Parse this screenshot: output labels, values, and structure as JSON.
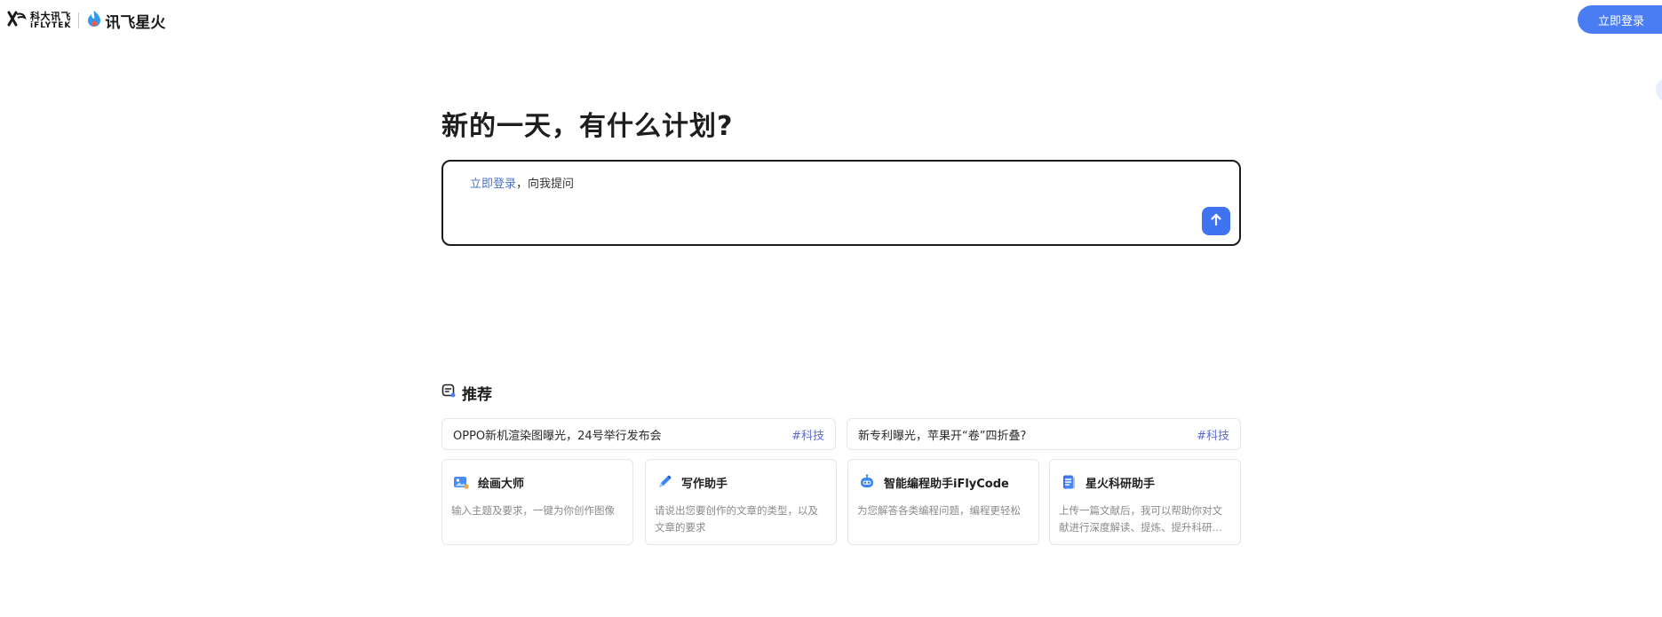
{
  "header": {
    "iflytek_logo_cn": "科大讯飞",
    "iflytek_logo_en": "iFLYTEK",
    "spark_logo_text": "讯飞星火",
    "login_button": "立即登录"
  },
  "main": {
    "greeting": "新的一天，有什么计划?",
    "input": {
      "login_link": "立即登录",
      "prompt_suffix": "，向我提问"
    }
  },
  "recommend": {
    "title": "推荐",
    "news": [
      {
        "text": "OPPO新机渲染图曝光，24号举行发布会",
        "tag": "#科技"
      },
      {
        "text": "新专利曝光，苹果开“卷”四折叠?",
        "tag": "#科技"
      }
    ],
    "cards": [
      {
        "title": "绘画大师",
        "desc": "输入主题及要求，一键为你创作图像",
        "icon": "paint-icon"
      },
      {
        "title": "写作助手",
        "desc": "请说出您要创作的文章的类型，以及文章的要求",
        "icon": "pen-icon"
      },
      {
        "title": "智能编程助手iFlyCode",
        "desc": "为您解答各类编程问题，编程更轻松",
        "icon": "robot-icon"
      },
      {
        "title": "星火科研助手",
        "desc": "上传一篇文献后，我可以帮助你对文献进行深度解读、提炼、提升科研效率",
        "icon": "document-icon"
      }
    ]
  },
  "colors": {
    "accent": "#4a7df4",
    "send_button": "#3f73f0",
    "link": "#4a72c9",
    "tag": "#5b6bd6"
  }
}
